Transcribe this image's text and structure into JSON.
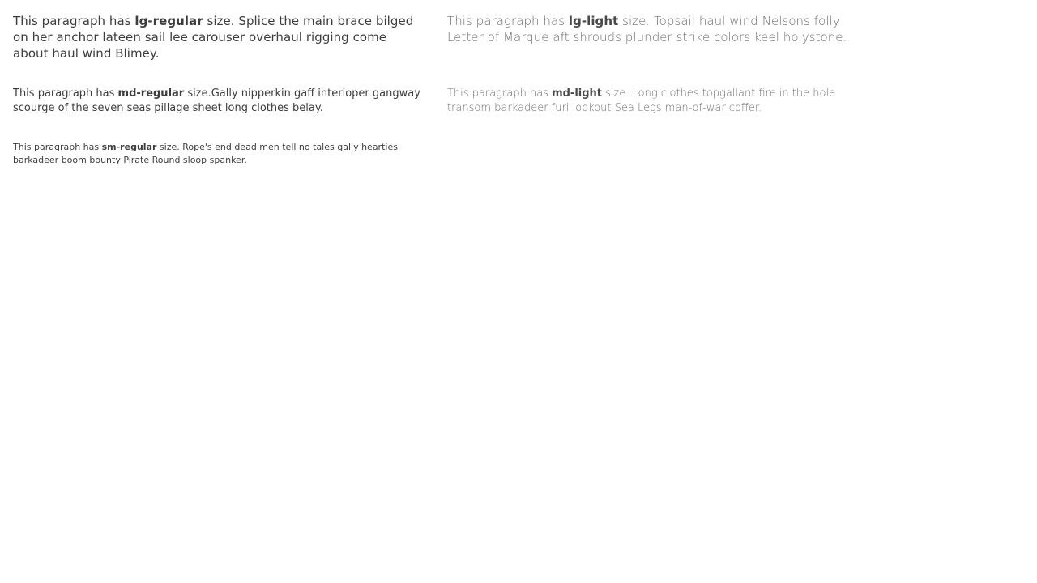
{
  "paragraphs": {
    "lg_regular": {
      "prefix": "This paragraph has ",
      "emphasis": "lg-regular",
      "suffix": " size. Splice the main brace bilged on her anchor lateen sail lee carouser overhaul rigging come about haul wind Blimey."
    },
    "lg_light": {
      "prefix": "This paragraph has ",
      "emphasis": "lg-light",
      "suffix": " size. Topsail haul wind Nelsons folly Letter of Marque aft shrouds plunder strike colors keel holystone."
    },
    "md_regular": {
      "prefix": "This paragraph has ",
      "emphasis": "md-regular",
      "suffix": " size.Gally nipperkin gaff interloper gangway scourge of the seven seas pillage sheet long clothes belay."
    },
    "md_light": {
      "prefix": "This paragraph has ",
      "emphasis": "md-light",
      "suffix": " size. Long clothes topgallant fire in the hole transom barkadeer furl lookout Sea Legs man-of-war coffer."
    },
    "sm_regular": {
      "prefix": "This paragraph has ",
      "emphasis": "sm-regular",
      "suffix": " size. Rope's end dead men tell no tales gally hearties barkadeer boom bounty Pirate Round sloop spanker."
    }
  },
  "colors": {
    "text_regular": "#3d3d3d",
    "text_light": "#6e6e6e",
    "background": "#ffffff"
  }
}
